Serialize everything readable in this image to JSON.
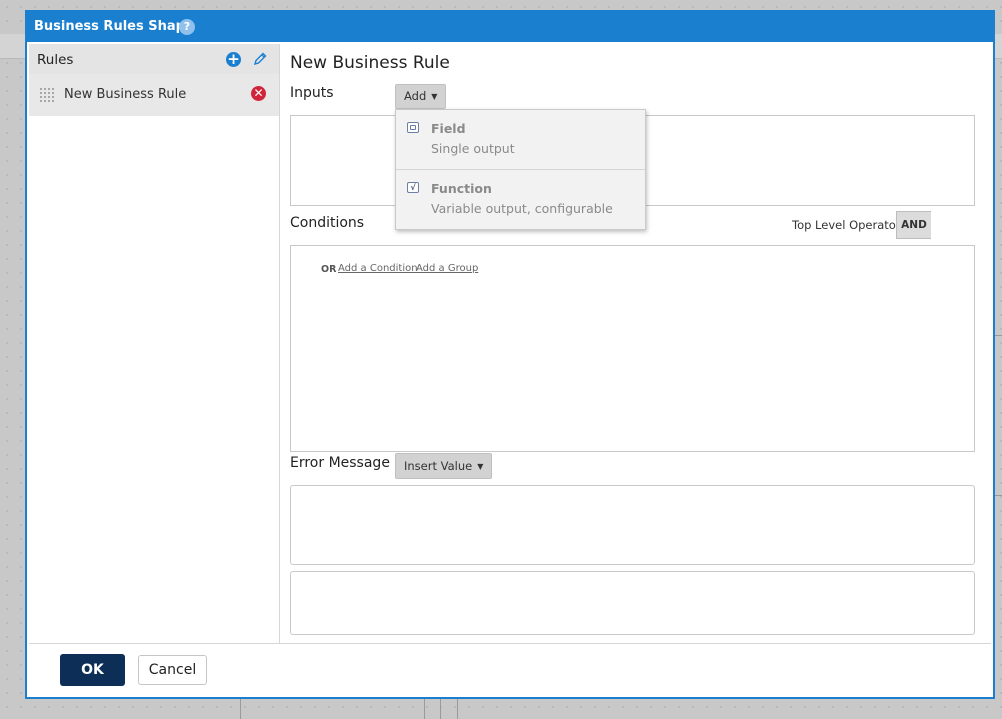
{
  "dialog": {
    "title": "Business Rules Shape",
    "help_icon": "help-icon",
    "help_glyph": "?"
  },
  "rules_panel": {
    "title": "Rules",
    "add_icon": "plus-circle-icon",
    "edit_icon": "pencil-icon",
    "items": [
      {
        "label": "New Business Rule",
        "drag_icon": "drag-handle-icon",
        "delete_icon": "delete-circle-icon"
      }
    ]
  },
  "editor": {
    "heading": "New Business Rule",
    "inputs": {
      "label": "Inputs",
      "add_button": "Add"
    },
    "add_menu": [
      {
        "title": "Field",
        "subtitle": "Single output",
        "icon": "field-icon"
      },
      {
        "title": "Function",
        "subtitle": "Variable output, configurable",
        "icon": "function-icon"
      }
    ],
    "conditions": {
      "label": "Conditions",
      "top_level_operator_label": "Top Level Operator",
      "operator_value": "AND",
      "or_label": "OR",
      "add_condition_link": "Add a Condition",
      "add_group_link": "Add a Group"
    },
    "error_message": {
      "label": "Error Message",
      "insert_value_button": "Insert Value"
    }
  },
  "footer": {
    "ok_label": "OK",
    "cancel_label": "Cancel"
  },
  "colors": {
    "accent": "#1b7fd0",
    "primary_button": "#0d2e56",
    "danger": "#d0243a"
  }
}
